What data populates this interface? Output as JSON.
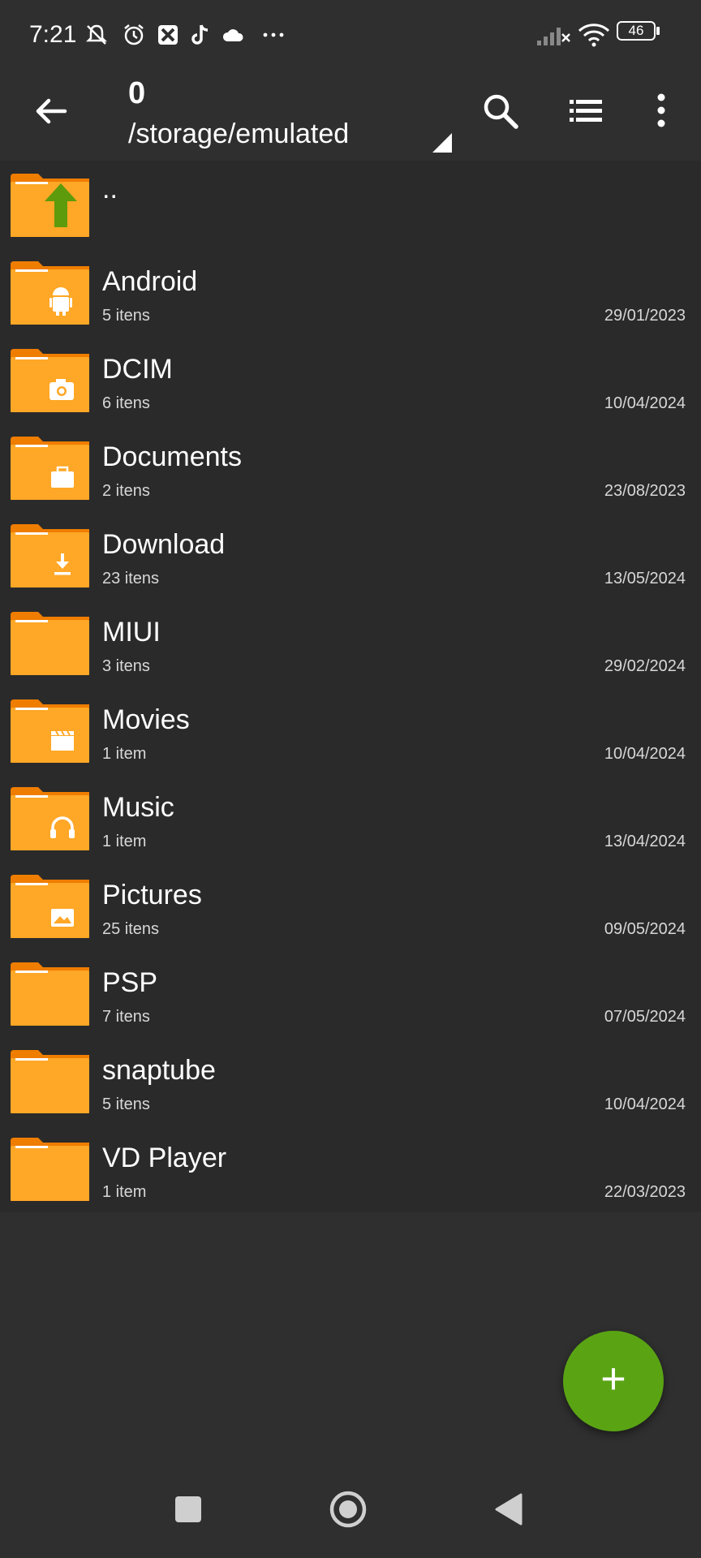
{
  "status_bar": {
    "time": "7:21",
    "battery": "46",
    "icons": [
      "notifications-off-icon",
      "alarm-icon",
      "app-icon",
      "tiktok-icon",
      "cloud-icon",
      "more-dots-icon",
      "signal-icon",
      "wifi-icon",
      "battery-icon"
    ]
  },
  "appbar": {
    "title": "0",
    "path": "/storage/emulated"
  },
  "colors": {
    "background": "#2f2f2f",
    "list_background": "#2a2a2a",
    "folder": "#ffa726",
    "folder_tab": "#ef7d00",
    "fab": "#5aa414",
    "up_arrow": "#5d9b0c"
  },
  "parent_row": {
    "label": ".."
  },
  "folders": [
    {
      "name": "Android",
      "count": "5 itens",
      "date": "29/01/2023",
      "icon": "android-icon"
    },
    {
      "name": "DCIM",
      "count": "6 itens",
      "date": "10/04/2024",
      "icon": "camera-icon"
    },
    {
      "name": "Documents",
      "count": "2 itens",
      "date": "23/08/2023",
      "icon": "briefcase-icon"
    },
    {
      "name": "Download",
      "count": "23 itens",
      "date": "13/05/2024",
      "icon": "download-icon"
    },
    {
      "name": "MIUI",
      "count": "3 itens",
      "date": "29/02/2024",
      "icon": ""
    },
    {
      "name": "Movies",
      "count": "1 item",
      "date": "10/04/2024",
      "icon": "clapperboard-icon"
    },
    {
      "name": "Music",
      "count": "1 item",
      "date": "13/04/2024",
      "icon": "headphones-icon"
    },
    {
      "name": "Pictures",
      "count": "25 itens",
      "date": "09/05/2024",
      "icon": "image-icon"
    },
    {
      "name": "PSP",
      "count": "7 itens",
      "date": "07/05/2024",
      "icon": ""
    },
    {
      "name": "snaptube",
      "count": "5 itens",
      "date": "10/04/2024",
      "icon": ""
    },
    {
      "name": "VD Player",
      "count": "1 item",
      "date": "22/03/2023",
      "icon": ""
    }
  ],
  "fab": {
    "label": "+"
  }
}
